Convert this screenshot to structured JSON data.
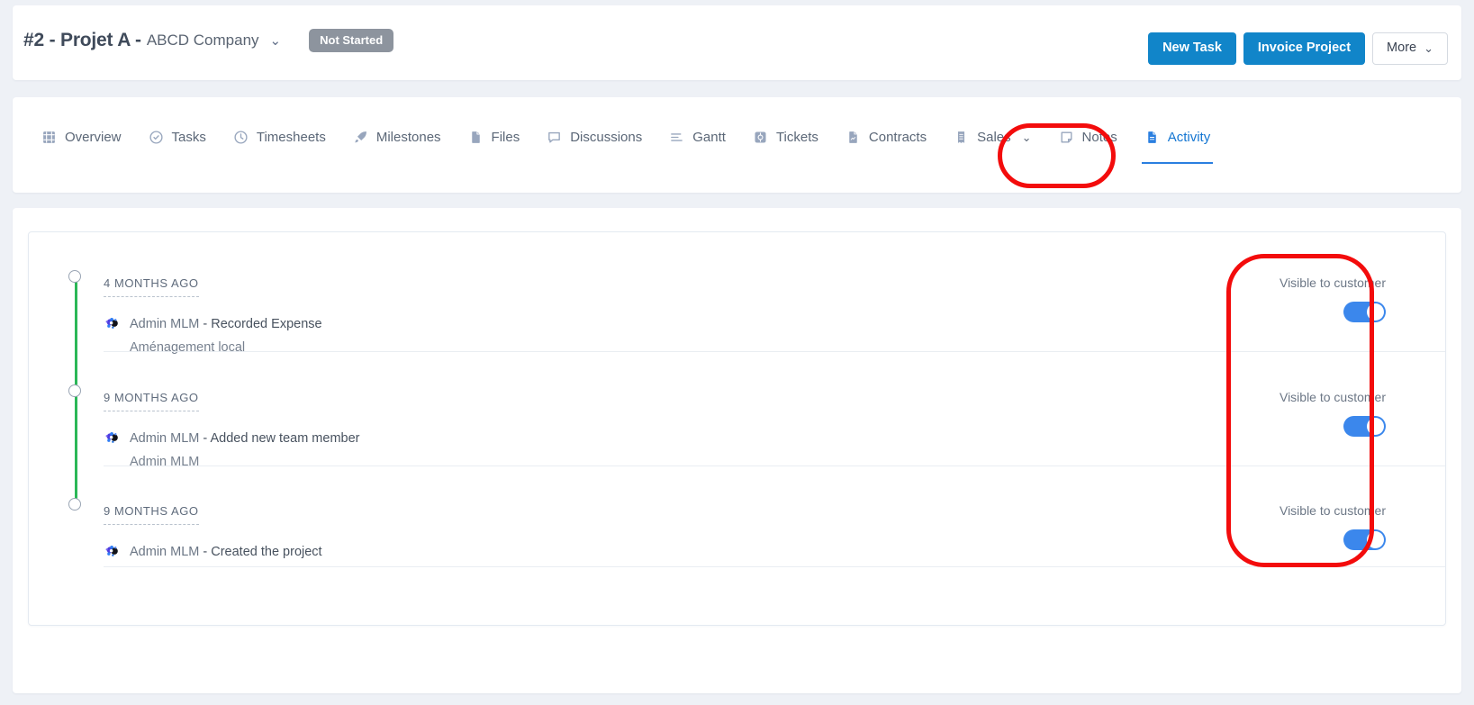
{
  "header": {
    "project_id": "#2 - Projet A -",
    "company": "ABCD Company",
    "company_caret": "⌄",
    "status": "Not Started",
    "buttons": {
      "new_task": "New Task",
      "invoice_project": "Invoice Project",
      "more": "More",
      "more_caret": "⌄"
    }
  },
  "tabs": [
    {
      "label": "Overview",
      "icon": "grid-icon",
      "active": false
    },
    {
      "label": "Tasks",
      "icon": "check-circle-icon",
      "active": false
    },
    {
      "label": "Timesheets",
      "icon": "clock-icon",
      "active": false
    },
    {
      "label": "Milestones",
      "icon": "rocket-icon",
      "active": false
    },
    {
      "label": "Files",
      "icon": "file-icon",
      "active": false
    },
    {
      "label": "Discussions",
      "icon": "chat-icon",
      "active": false
    },
    {
      "label": "Gantt",
      "icon": "gantt-icon",
      "active": false
    },
    {
      "label": "Tickets",
      "icon": "ticket-icon",
      "active": false
    },
    {
      "label": "Contracts",
      "icon": "contract-icon",
      "active": false
    },
    {
      "label": "Sales",
      "icon": "receipt-icon",
      "active": false,
      "caret": "⌄"
    },
    {
      "label": "Notes",
      "icon": "note-icon",
      "active": false
    },
    {
      "label": "Activity",
      "icon": "document-icon",
      "active": true
    }
  ],
  "activity": {
    "entries": [
      {
        "date": "4 MONTHS AGO",
        "actor": "Admin MLM",
        "separator": " - ",
        "action": "Recorded Expense",
        "detail": "Aménagement local",
        "visibility_label": "Visible to customer",
        "visible": true
      },
      {
        "date": "9 MONTHS AGO",
        "actor": "Admin MLM",
        "separator": " - ",
        "action": "Added new team member",
        "detail": "Admin MLM",
        "visibility_label": "Visible to customer",
        "visible": true
      },
      {
        "date": "9 MONTHS AGO",
        "actor": "Admin MLM",
        "separator": " - ",
        "action": "Created the project",
        "detail": "",
        "visibility_label": "Visible to customer",
        "visible": true
      }
    ]
  },
  "colors": {
    "accent_blue": "#1185c9",
    "active_tab": "#1476d2",
    "timeline_green": "#2bb757",
    "toggle_on": "#3b87ec",
    "status_gray": "#8d949e",
    "annotation_red": "#f30c0c",
    "page_bg": "#eef1f6"
  }
}
